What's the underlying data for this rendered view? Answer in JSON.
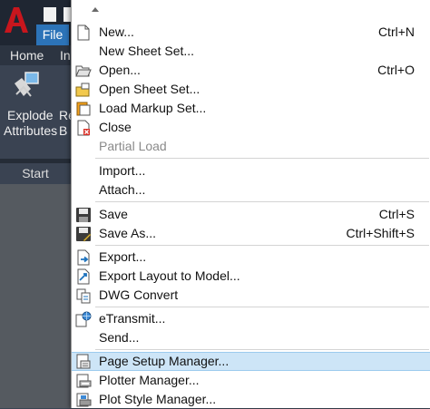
{
  "titlebar": {
    "file_tab": "File"
  },
  "ribbon": {
    "tabs": [
      "Home",
      "In"
    ],
    "buttons": {
      "explode_attributes": [
        "Explode",
        "Attributes"
      ],
      "partial_second": [
        "Re",
        "B"
      ]
    }
  },
  "doc_tabs": {
    "start": "Start"
  },
  "menu": {
    "items": [
      {
        "label": "New...",
        "shortcut": "Ctrl+N",
        "icon": "new-document-icon"
      },
      {
        "label": "New Sheet Set...",
        "shortcut": "",
        "icon": ""
      },
      {
        "label": "Open...",
        "shortcut": "Ctrl+O",
        "icon": "open-folder-icon"
      },
      {
        "label": "Open Sheet Set...",
        "shortcut": "",
        "icon": "open-sheet-set-icon"
      },
      {
        "label": "Load Markup Set...",
        "shortcut": "",
        "icon": "load-markup-icon"
      },
      {
        "label": "Close",
        "shortcut": "",
        "icon": "close-document-icon"
      },
      {
        "label": "Partial Load",
        "shortcut": "",
        "icon": ""
      },
      {
        "label": "Import...",
        "shortcut": "",
        "icon": ""
      },
      {
        "label": "Attach...",
        "shortcut": "",
        "icon": ""
      },
      {
        "label": "Save",
        "shortcut": "Ctrl+S",
        "icon": "save-icon"
      },
      {
        "label": "Save As...",
        "shortcut": "Ctrl+Shift+S",
        "icon": "save-as-icon"
      },
      {
        "label": "Export...",
        "shortcut": "",
        "icon": "export-icon"
      },
      {
        "label": "Export Layout to Model...",
        "shortcut": "",
        "icon": "export-layout-icon"
      },
      {
        "label": "DWG Convert",
        "shortcut": "",
        "icon": "dwg-convert-icon"
      },
      {
        "label": "eTransmit...",
        "shortcut": "",
        "icon": "etransmit-icon"
      },
      {
        "label": "Send...",
        "shortcut": "",
        "icon": ""
      },
      {
        "label": "Page Setup Manager...",
        "shortcut": "",
        "icon": "page-setup-icon"
      },
      {
        "label": "Plotter Manager...",
        "shortcut": "",
        "icon": "plotter-manager-icon"
      },
      {
        "label": "Plot Style Manager...",
        "shortcut": "",
        "icon": "plot-style-icon"
      }
    ]
  }
}
